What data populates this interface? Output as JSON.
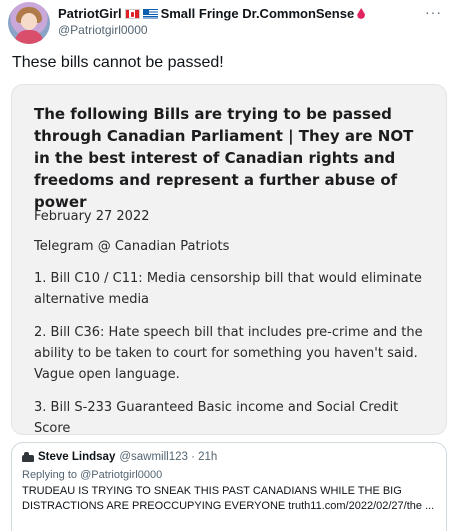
{
  "author": {
    "display_name": "PatriotGirl",
    "display_name_suffix": "Small Fringe Dr.CommonSense",
    "handle": "@Patriotgirl0000"
  },
  "more_label": "···",
  "tweet_text": "These bills cannot be passed!",
  "image": {
    "heading": "The following Bills are trying to be passed through Canadian Parliament | They are NOT in the best interest of Canadian rights and freedoms and represent a further abuse of power",
    "date": "February 27 2022",
    "telegram": "Telegram @ Canadian Patriots",
    "bill1": "1. Bill C10 / C11: Media censorship bill that would eliminate alternative media",
    "bill2": "2. Bill C36: Hate speech bill that includes pre-crime and the ability to be taken to court for something you haven't said. Vague open language.",
    "bill3": "3. Bill S-233 Guaranteed Basic income and Social Credit Score"
  },
  "quote": {
    "name": "Steve Lindsay",
    "meta": "@sawmill123 · 21h",
    "replying_to": "Replying to @Patriotgirl0000",
    "body": "TRUDEAU IS TRYING TO SNEAK THIS PAST CANADIANS WHILE THE BIG DISTRACTIONS ARE PREOCCUPYING EVERYONE truth11.com/2022/02/27/the ..."
  },
  "colors": {
    "canada_red": "#e01e26",
    "greece_blue": "#0d5eaf",
    "drop_red": "#e0245e",
    "secondary_text": "#536471"
  },
  "icons": [
    "avatar",
    "flag-canada-icon",
    "flag-greece-icon",
    "blood-drop-icon",
    "more-options-icon",
    "truck-icon"
  ]
}
